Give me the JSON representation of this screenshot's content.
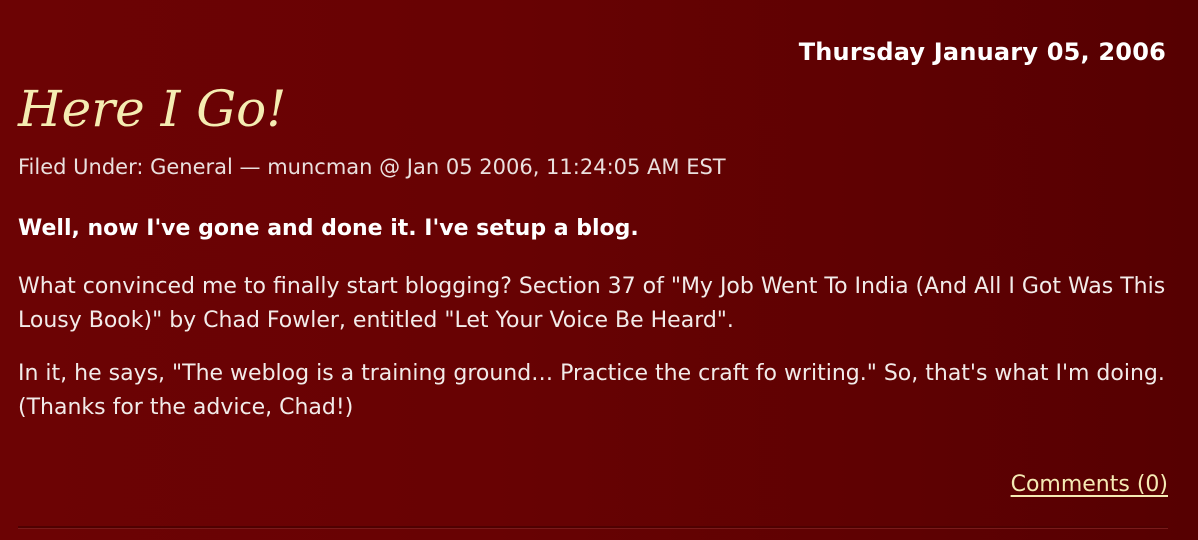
{
  "post": {
    "date": "Thursday January 05, 2006",
    "title": "Here I Go!",
    "meta": "Filed Under: General — muncman @ Jan 05 2006, 11:24:05 AM EST",
    "paragraphs": [
      "Well, now I've gone and done it. I've setup a blog.",
      "What convinced me to finally start blogging? Section 37 of \"My Job Went To India (And All I Got Was This Lousy Book)\" by Chad Fowler, entitled \"Let Your Voice Be Heard\".",
      "In it, he says, \"The weblog is a training ground… Practice the craft fo writing.\" So, that's what I'm doing. (Thanks for the advice, Chad!)"
    ],
    "comments_label": "Comments (0)"
  },
  "colors": {
    "background": "#680203",
    "title": "#f5ecb2",
    "link": "#f5eab4",
    "text": "#f2ebe9"
  }
}
